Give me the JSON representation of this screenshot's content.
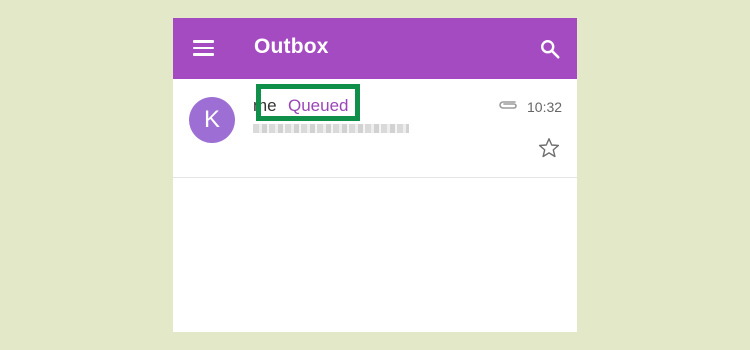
{
  "app": {
    "title": "Outbox"
  },
  "icons": {
    "menu": "menu-icon",
    "search": "search-icon",
    "attachment": "paperclip-icon",
    "star": "star-outline-icon"
  },
  "message": {
    "avatar_letter": "K",
    "sender": "me",
    "status": "Queued",
    "time": "10:32"
  },
  "colors": {
    "appbar": "#a54bc1",
    "avatar": "#9d6fd4",
    "status": "#9a46b8",
    "highlight_box": "#0f8f4a",
    "background": "#e2e8c8"
  }
}
